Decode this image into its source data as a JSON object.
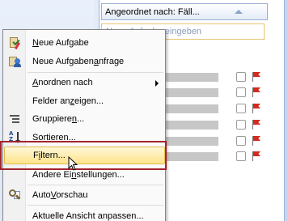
{
  "task_pane": {
    "arrange_label": "Angeordnet nach: Fäll...",
    "new_task_placeholder": "Neue Aufgabe eingeben",
    "task_rows": 6
  },
  "context_menu": {
    "items": [
      {
        "label_pre": "",
        "accel": "N",
        "label_post": "eue Aufgabe",
        "icon": "new-task-icon"
      },
      {
        "label_pre": "Neue Aufgaben",
        "accel": "a",
        "label_post": "nfrage",
        "icon": "task-request-icon"
      },
      {
        "label_pre": "",
        "accel": "A",
        "label_post": "nordnen nach",
        "icon": "",
        "submenu": true
      },
      {
        "label_pre": "Felder an",
        "accel": "z",
        "label_post": "eigen...",
        "icon": ""
      },
      {
        "label_pre": "Gruppiere",
        "accel": "n",
        "label_post": "...",
        "icon": "group-icon"
      },
      {
        "label_pre": "S",
        "accel": "o",
        "label_post": "rtieren...",
        "icon": "sort-icon"
      },
      {
        "label_pre": "F",
        "accel": "i",
        "label_post": "ltern...",
        "icon": ""
      },
      {
        "label_pre": "Andere Ei",
        "accel": "n",
        "label_post": "stellungen...",
        "icon": ""
      },
      {
        "label_pre": "Auto",
        "accel": "V",
        "label_post": "orschau",
        "icon": "autopreview-icon"
      },
      {
        "label_pre": "Aktuelle Ansicht anpassen...",
        "accel": "",
        "label_post": "",
        "icon": ""
      }
    ],
    "hovered_index": 6
  },
  "colors": {
    "highlight_frame": "#a5222c",
    "hover_fill": "#ffe48a",
    "flag": "#d22b20"
  }
}
